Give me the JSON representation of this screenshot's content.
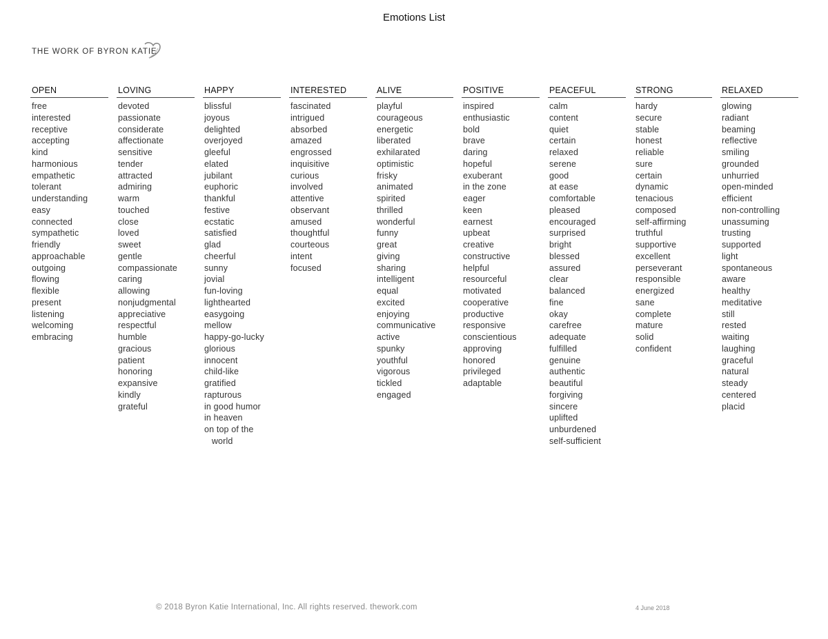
{
  "document": {
    "title": "Emotions List",
    "logo_text": "THE WORK OF BYRON KATIE",
    "logo_icon": "heart-outline-icon"
  },
  "columns": [
    {
      "header": "OPEN",
      "items": [
        "free",
        "interested",
        "receptive",
        "accepting",
        "kind",
        "harmonious",
        "empathetic",
        "tolerant",
        "understanding",
        "easy",
        "connected",
        "sympathetic",
        "friendly",
        "approachable",
        "outgoing",
        "flowing",
        "flexible",
        "present",
        "listening",
        "welcoming",
        "embracing"
      ]
    },
    {
      "header": "LOVING",
      "items": [
        "devoted",
        "passionate",
        "considerate",
        "affectionate",
        "sensitive",
        "tender",
        "attracted",
        "admiring",
        "warm",
        "touched",
        "close",
        "loved",
        "sweet",
        "gentle",
        "compassionate",
        "caring",
        "allowing",
        "nonjudgmental",
        "appreciative",
        "respectful",
        "humble",
        "gracious",
        "patient",
        "honoring",
        "expansive",
        "kindly",
        "grateful"
      ]
    },
    {
      "header": "HAPPY",
      "items": [
        "blissful",
        "joyous",
        "delighted",
        "overjoyed",
        "gleeful",
        "elated",
        "jubilant",
        "euphoric",
        "thankful",
        "festive",
        "ecstatic",
        "satisfied",
        "glad",
        "cheerful",
        "sunny",
        "jovial",
        "fun-loving",
        "lighthearted",
        "easygoing",
        "mellow",
        "happy-go-lucky",
        "glorious",
        "innocent",
        "child-like",
        "gratified",
        "rapturous",
        "in good humor",
        "in heaven",
        "on top of the",
        "   world"
      ]
    },
    {
      "header": "INTERESTED",
      "items": [
        "fascinated",
        "intrigued",
        "absorbed",
        "amazed",
        "engrossed",
        "inquisitive",
        "curious",
        "involved",
        "attentive",
        "observant",
        "amused",
        "thoughtful",
        "courteous",
        "intent",
        "focused"
      ]
    },
    {
      "header": "ALIVE",
      "items": [
        "playful",
        "courageous",
        "energetic",
        "liberated",
        "exhilarated",
        "optimistic",
        "frisky",
        "animated",
        "spirited",
        "thrilled",
        "wonderful",
        "funny",
        "great",
        "giving",
        "sharing",
        "intelligent",
        "equal",
        "excited",
        "enjoying",
        "communicative",
        "active",
        "spunky",
        "youthful",
        "vigorous",
        "tickled",
        "engaged"
      ]
    },
    {
      "header": "POSITIVE",
      "items": [
        "inspired",
        "enthusiastic",
        "bold",
        "brave",
        "daring",
        "hopeful",
        "exuberant",
        "in the zone",
        "eager",
        "keen",
        "earnest",
        "upbeat",
        "creative",
        "constructive",
        "helpful",
        "resourceful",
        "motivated",
        "cooperative",
        "productive",
        "responsive",
        "conscientious",
        "approving",
        "honored",
        "privileged",
        "adaptable"
      ]
    },
    {
      "header": "PEACEFUL",
      "items": [
        "calm",
        "content",
        "quiet",
        "certain",
        "relaxed",
        "serene",
        "good",
        "at ease",
        "comfortable",
        "pleased",
        "encouraged",
        "surprised",
        "bright",
        "blessed",
        "assured",
        "clear",
        "balanced",
        "fine",
        "okay",
        "carefree",
        "adequate",
        "fulfilled",
        "genuine",
        "authentic",
        "beautiful",
        "forgiving",
        "sincere",
        "uplifted",
        "unburdened",
        "self-sufficient"
      ]
    },
    {
      "header": "STRONG",
      "items": [
        "hardy",
        "secure",
        "stable",
        "honest",
        "reliable",
        "sure",
        "certain",
        "dynamic",
        "tenacious",
        "composed",
        "self-affirming",
        "truthful",
        "supportive",
        "excellent",
        "perseverant",
        "responsible",
        "energized",
        "sane",
        "complete",
        "mature",
        "solid",
        "confident"
      ]
    },
    {
      "header": "RELAXED",
      "items": [
        "glowing",
        "radiant",
        "beaming",
        "reflective",
        "smiling",
        "grounded",
        "unhurried",
        "open-minded",
        "efficient",
        "non-controlling",
        "unassuming",
        "trusting",
        "supported",
        "light",
        "spontaneous",
        "aware",
        "healthy",
        "meditative",
        "still",
        "rested",
        "waiting",
        "laughing",
        "graceful",
        "natural",
        "steady",
        "centered",
        "placid"
      ]
    }
  ],
  "footer": {
    "copyright": "© 2018 Byron Katie International, Inc. All rights reserved. thework.com",
    "date": "4 June 2018"
  }
}
